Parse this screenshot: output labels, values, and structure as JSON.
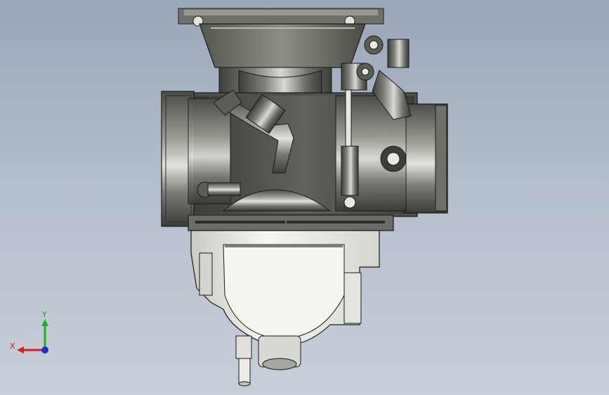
{
  "viewport": {
    "background_top": "#9aa6b9",
    "background_bottom": "#c8cfd9",
    "model_description": "carburetor"
  },
  "triad": {
    "x_label": "X",
    "y_label": "Y",
    "x_color": "#d42020",
    "y_color": "#20b020",
    "z_color": "#2030d0"
  }
}
